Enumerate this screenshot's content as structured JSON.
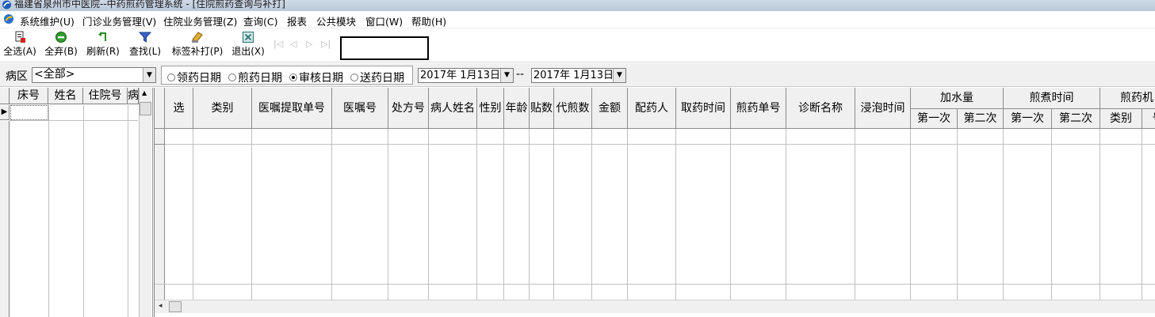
{
  "window": {
    "title": "福建省泉州市中医院--中药煎药管理系统 - [住院煎药查询与补打]",
    "icon": "app-logo-icon"
  },
  "menu": {
    "items": [
      "系统维护(U)",
      "门诊业务管理(V)",
      "住院业务管理(Z)",
      "查询(C)",
      "报表",
      "公共模块",
      "窗口(W)",
      "帮助(H)"
    ]
  },
  "toolbar": {
    "buttons": [
      {
        "label": "全选(A)",
        "icon": "select-all-icon"
      },
      {
        "label": "全弃(B)",
        "icon": "discard-all-icon"
      },
      {
        "label": "刷新(R)",
        "icon": "refresh-icon"
      },
      {
        "label": "查找(L)",
        "icon": "filter-icon"
      },
      {
        "label": "标签补打(P)",
        "icon": "print-label-icon"
      },
      {
        "label": "退出(X)",
        "icon": "exit-icon"
      }
    ],
    "nav": [
      "|◁",
      "◁",
      "▷",
      "▷|"
    ]
  },
  "filter": {
    "ward_label": "病区",
    "ward_value": "<全部>",
    "radios": [
      {
        "label": "领药日期",
        "checked": false
      },
      {
        "label": "煎药日期",
        "checked": false
      },
      {
        "label": "审核日期",
        "checked": true
      },
      {
        "label": "送药日期",
        "checked": false
      }
    ],
    "date_from": "2017年  1月13日",
    "date_sep": "--",
    "date_to": "2017年  1月13日"
  },
  "left_grid": {
    "columns": [
      "床号",
      "姓名",
      "住院号",
      "病"
    ],
    "current_row_marker": "▶"
  },
  "right_grid": {
    "columns": [
      "选",
      "类别",
      "医嘱提取单号",
      "医嘱号",
      "处方号",
      "病人姓名",
      "性别",
      "年龄",
      "贴数",
      "代煎数",
      "金额",
      "配药人",
      "取药时间",
      "煎药单号",
      "诊断名称",
      "浸泡时间"
    ],
    "groups": [
      {
        "label": "加水量",
        "sub": [
          "第一次",
          "第二次"
        ]
      },
      {
        "label": "煎煮时间",
        "sub": [
          "第一次",
          "第二次"
        ]
      },
      {
        "label": "煎药机",
        "sub": [
          "类别",
          "号"
        ]
      }
    ]
  },
  "colors": {
    "title_bg": "#c7d3e2",
    "header_bg": "#f0f0f0",
    "grid_line": "#c0c0c0"
  }
}
